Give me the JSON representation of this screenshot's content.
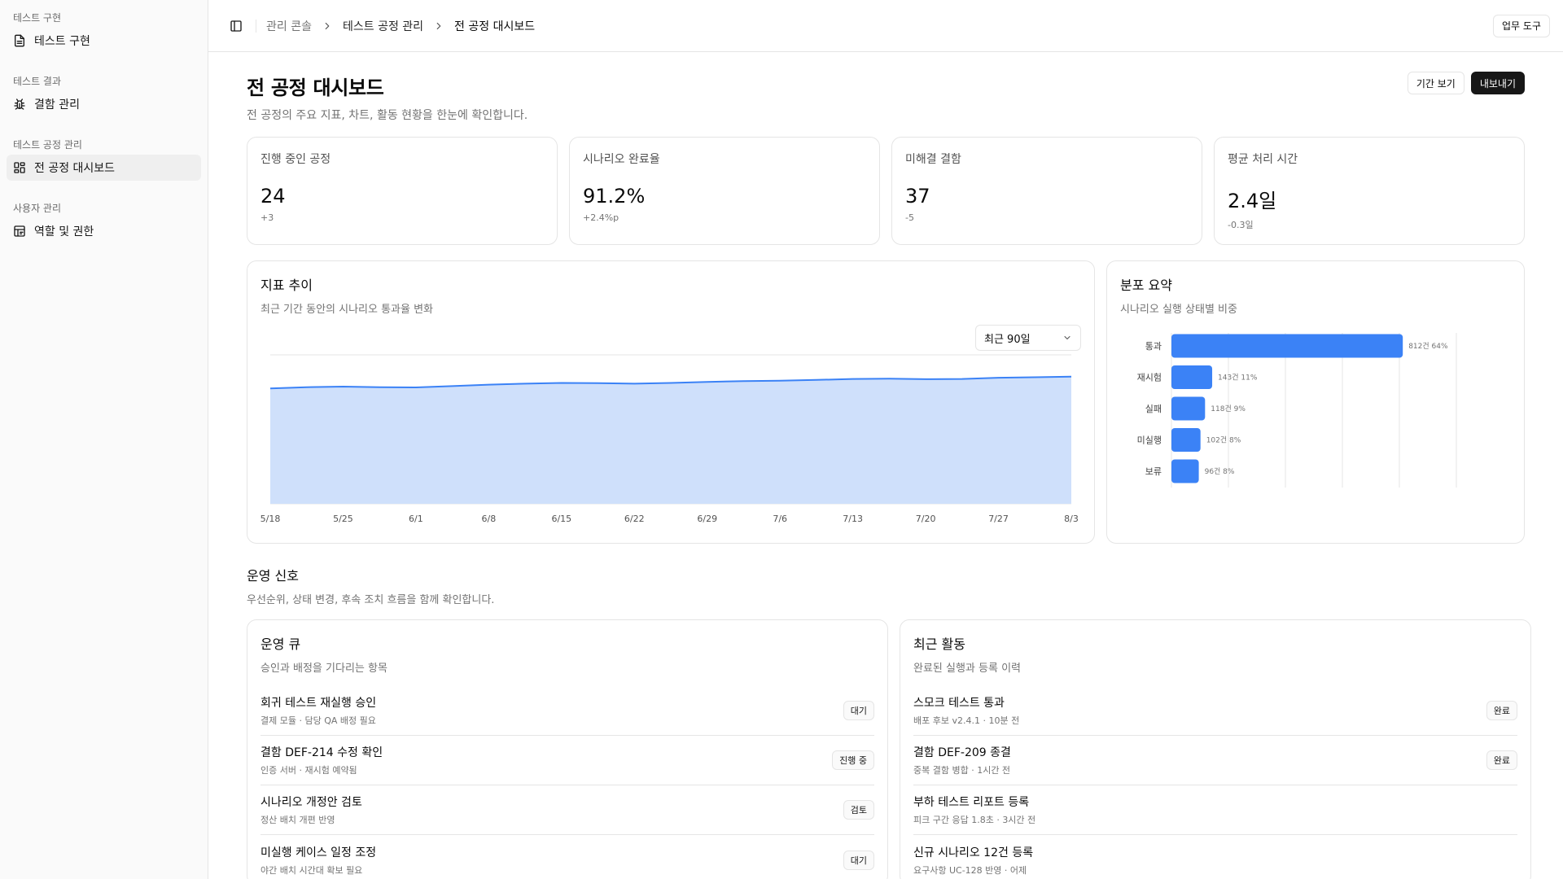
{
  "sidebar": {
    "groups": [
      {
        "label": "테스트 구현",
        "items": [
          {
            "label": "테스트 구현",
            "icon": "file-text-icon"
          }
        ]
      },
      {
        "label": "테스트 결과",
        "items": [
          {
            "label": "결함 관리",
            "icon": "bug-icon"
          }
        ]
      },
      {
        "label": "테스트 공정 관리",
        "items": [
          {
            "label": "전 공정 대시보드",
            "icon": "layout-grid-icon",
            "active": true
          }
        ]
      },
      {
        "label": "사용자 관리",
        "items": [
          {
            "label": "역할 및 권한",
            "icon": "shield-grid-icon"
          }
        ]
      }
    ]
  },
  "header": {
    "breadcrumb": [
      "관리 콘솔",
      "테스트 공정 관리",
      "전 공정 대시보드"
    ],
    "tools_label": "업무 도구"
  },
  "page": {
    "title": "전 공정 대시보드",
    "subtitle": "전 공정의 주요 지표, 차트, 활동 현황을 한눈에 확인합니다.",
    "period_label": "기간 보기",
    "export_label": "내보내기"
  },
  "kpis": [
    {
      "label": "진행 중인 공정",
      "value": "24",
      "delta": "+3"
    },
    {
      "label": "시나리오 완료율",
      "value": "91.2%",
      "delta": "+2.4%p"
    },
    {
      "label": "미해결 결함",
      "value": "37",
      "delta": "-5"
    },
    {
      "label": "평균 처리 시간",
      "value": "2.4일",
      "delta": "-0.3일"
    }
  ],
  "trend": {
    "title": "지표 추이",
    "desc": "최근 기간 동안의 시나리오 통과율 변화",
    "range_label": "최근 90일"
  },
  "distribution": {
    "title": "분포 요약",
    "desc": "시나리오 실행 상태별 비중"
  },
  "chart_data": [
    {
      "type": "area",
      "x": [
        "5/18",
        "5/21",
        "5/25",
        "5/28",
        "6/1",
        "6/4",
        "6/8",
        "6/11",
        "6/15",
        "6/18",
        "6/22",
        "6/25",
        "6/29",
        "7/2",
        "7/6",
        "7/9",
        "7/13",
        "7/16",
        "7/20",
        "7/23",
        "7/27",
        "7/30",
        "8/3"
      ],
      "values": [
        86.5,
        87.0,
        87.2,
        87.0,
        86.9,
        87.4,
        88.0,
        88.4,
        88.7,
        88.6,
        88.4,
        88.7,
        89.1,
        89.4,
        89.6,
        89.9,
        90.3,
        90.4,
        90.2,
        90.3,
        90.8,
        91.0,
        91.2
      ],
      "xticks": [
        "5/18",
        "5/25",
        "6/1",
        "6/8",
        "6/15",
        "6/22",
        "6/29",
        "7/6",
        "7/13",
        "7/20",
        "7/27",
        "8/3"
      ],
      "ylim": [
        40,
        100
      ],
      "grid": true,
      "color": "#3b82f6",
      "fill": "#cfe0fb"
    },
    {
      "type": "bar",
      "orientation": "horizontal",
      "categories": [
        "통과",
        "재시험",
        "실패",
        "미실행",
        "보류"
      ],
      "values": [
        812,
        143,
        118,
        102,
        96
      ],
      "labels": [
        "812건 64%",
        "143건 11%",
        "118건 9%",
        "102건 8%",
        "96건 8%"
      ],
      "xlim": [
        0,
        1000
      ],
      "grid": true,
      "color": "#3b82f6"
    }
  ],
  "signals": {
    "title": "운영 신호",
    "desc": "우선순위, 상태 변경, 후속 조치 흐름을 함께 확인합니다."
  },
  "queue": {
    "title": "운영 큐",
    "desc": "승인과 배정을 기다리는 항목",
    "items": [
      {
        "title": "회귀 테스트 재실행 승인",
        "sub": "결제 모듈 · 담당 QA 배정 필요",
        "badge": "대기"
      },
      {
        "title": "결함 DEF-214 수정 확인",
        "sub": "인증 서버 · 재시험 예약됨",
        "badge": "진행 중"
      },
      {
        "title": "시나리오 개정안 검토",
        "sub": "정산 배치 개편 반영",
        "badge": "검토"
      },
      {
        "title": "미실행 케이스 일정 조정",
        "sub": "야간 배치 시간대 확보 필요",
        "badge": "대기"
      }
    ]
  },
  "activity": {
    "title": "최근 활동",
    "desc": "완료된 실행과 등록 이력",
    "items": [
      {
        "title": "스모크 테스트 통과",
        "sub": "배포 후보 v2.4.1 · 10분 전",
        "badge": "완료"
      },
      {
        "title": "결함 DEF-209 종결",
        "sub": "중복 결함 병합 · 1시간 전",
        "badge": "완료"
      },
      {
        "title": "부하 테스트 리포트 등록",
        "sub": "피크 구간 응답 1.8초 · 3시간 전",
        "badge": ""
      },
      {
        "title": "신규 시나리오 12건 등록",
        "sub": "요구사항 UC-128 반영 · 어제",
        "badge": ""
      }
    ]
  }
}
